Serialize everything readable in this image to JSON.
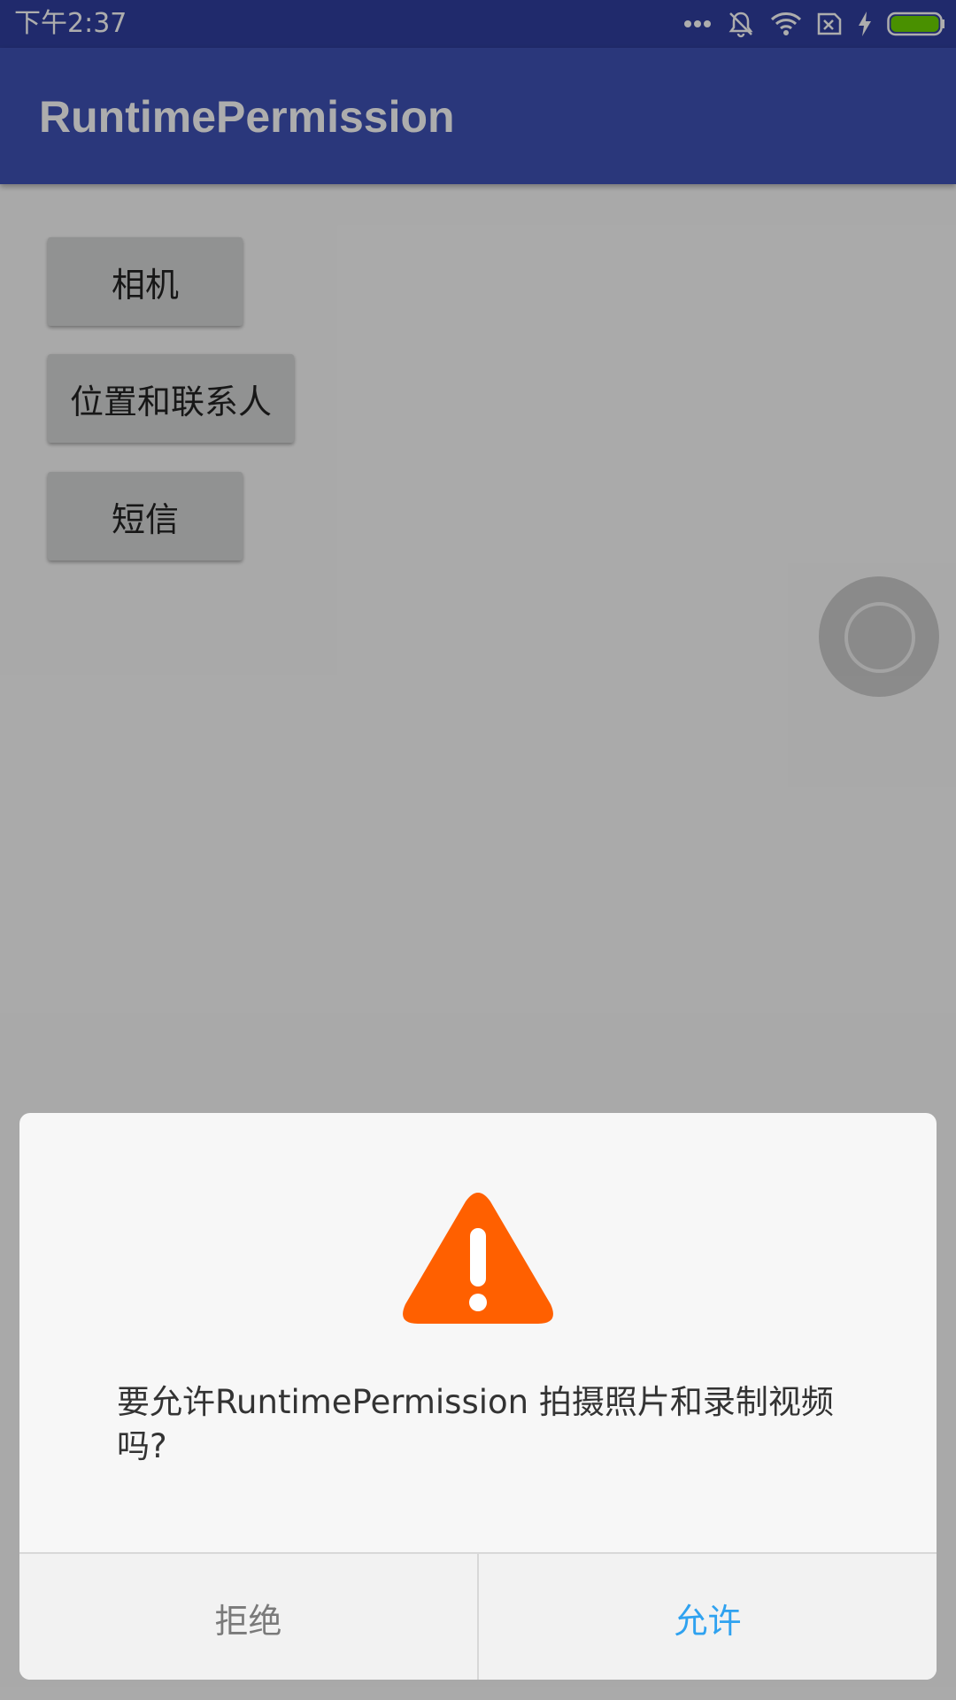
{
  "status_bar": {
    "time": "下午2:37",
    "icons": [
      "more-dots-icon",
      "mute-icon",
      "wifi-icon",
      "no-sim-icon",
      "charging-icon",
      "battery-icon"
    ]
  },
  "app_bar": {
    "title": "RuntimePermission"
  },
  "buttons": {
    "camera": "相机",
    "location_contacts": "位置和联系人",
    "sms": "短信"
  },
  "dialog": {
    "icon": "warning-icon",
    "message": "要允许RuntimePermission 拍摄照片和录制视频吗?",
    "deny_label": "拒绝",
    "allow_label": "允许"
  },
  "colors": {
    "primary": "#3f51b5",
    "primary_dark": "#303f9f",
    "warning": "#ff6000",
    "allow": "#2fa2f0",
    "battery": "#6cd400"
  }
}
